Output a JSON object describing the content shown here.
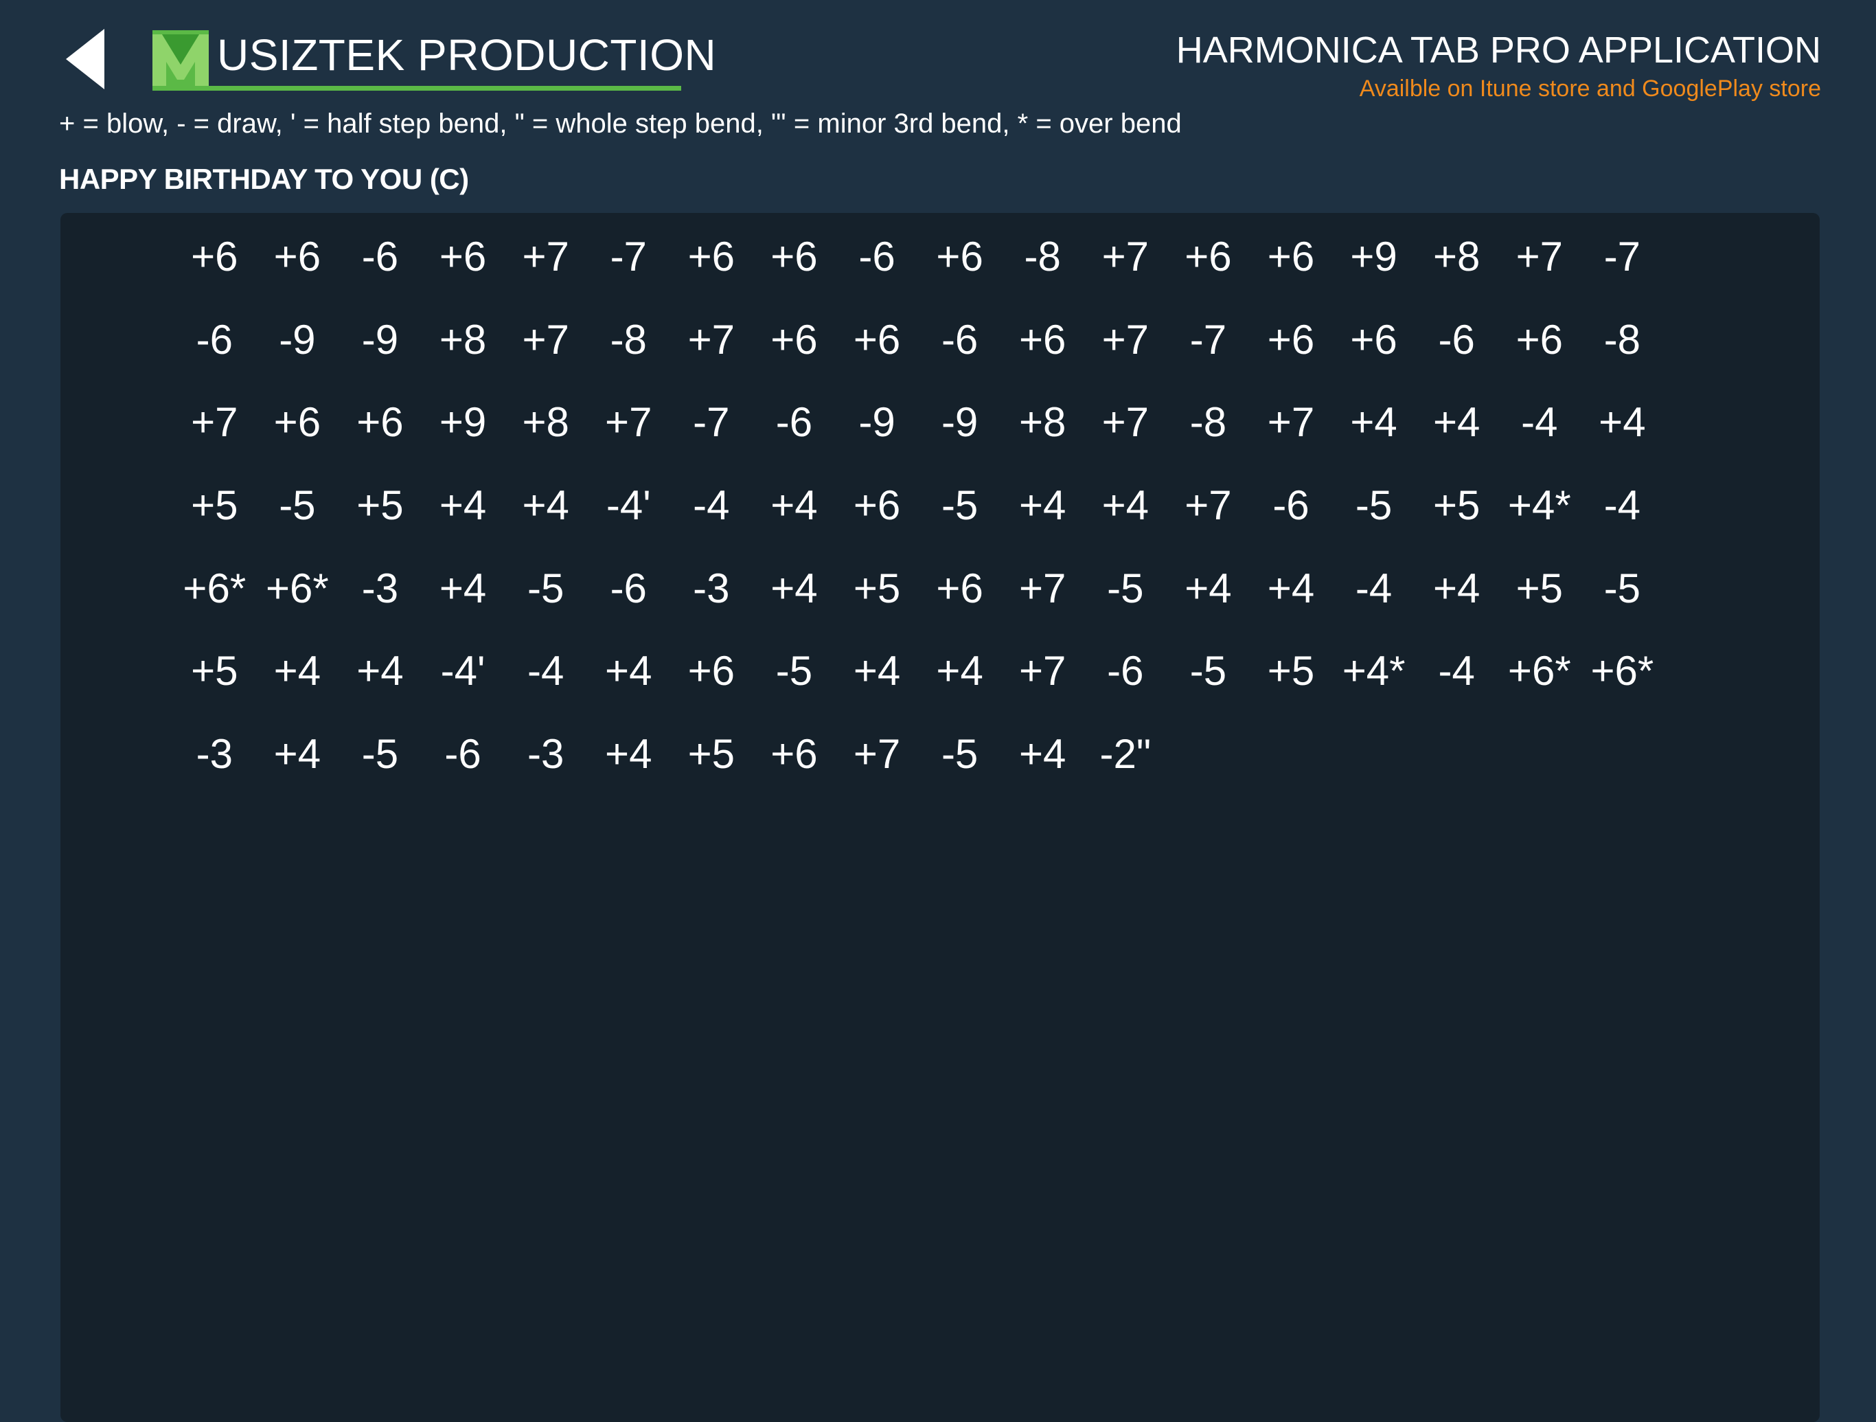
{
  "header": {
    "back_icon": "back-arrow-icon",
    "brand": {
      "logo_letter": "M",
      "logo_color": "#5bb946",
      "name": "USIZTEK PRODUCTION"
    },
    "promo": {
      "title": "HARMONICA TAB PRO APPLICATION",
      "subtitle": "Availble on Itune store and GooglePlay store",
      "subtitle_color": "#f08a1c"
    }
  },
  "legend": "+ = blow, - = draw, ' = half step bend, \" = whole step bend, \"' = minor 3rd bend, * = over bend",
  "song": {
    "title": "HAPPY BIRTHDAY TO YOU (C)",
    "rows": [
      [
        "+6",
        "+6",
        "-6",
        "+6",
        "+7",
        "-7",
        "+6",
        "+6",
        "-6",
        "+6",
        "-8",
        "+7",
        "+6",
        "+6",
        "+9",
        "+8",
        "+7",
        "-7"
      ],
      [
        "-6",
        "-9",
        "-9",
        "+8",
        "+7",
        "-8",
        "+7",
        "+6",
        "+6",
        "-6",
        "+6",
        "+7",
        "-7",
        "+6",
        "+6",
        "-6",
        "+6",
        "-8"
      ],
      [
        "+7",
        "+6",
        "+6",
        "+9",
        "+8",
        "+7",
        "-7",
        "-6",
        "-9",
        "-9",
        "+8",
        "+7",
        "-8",
        "+7",
        "+4",
        "+4",
        "-4",
        "+4"
      ],
      [
        "+5",
        "-5",
        "+5",
        "+4",
        "+4",
        "-4'",
        "-4",
        "+4",
        "+6",
        "-5",
        "+4",
        "+4",
        "+7",
        "-6",
        "-5",
        "+5",
        "+4*",
        "-4"
      ],
      [
        "+6*",
        "+6*",
        "-3",
        "+4",
        "-5",
        "-6",
        "-3",
        "+4",
        "+5",
        "+6",
        "+7",
        "-5",
        "+4",
        "+4",
        "-4",
        "+4",
        "+5",
        "-5"
      ],
      [
        "+5",
        "+4",
        "+4",
        "-4'",
        "-4",
        "+4",
        "+6",
        "-5",
        "+4",
        "+4",
        "+7",
        "-6",
        "-5",
        "+5",
        "+4*",
        "-4",
        "+6*",
        "+6*"
      ],
      [
        "-3",
        "+4",
        "-5",
        "-6",
        "-3",
        "+4",
        "+5",
        "+6",
        "+7",
        "-5",
        "+4",
        "-2\""
      ]
    ]
  },
  "colors": {
    "background": "#1e3142",
    "panel": "#15212b",
    "text": "#ffffff"
  }
}
